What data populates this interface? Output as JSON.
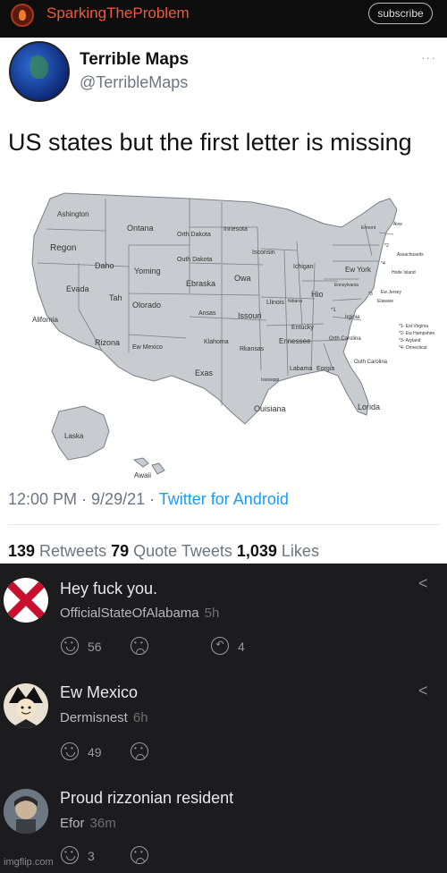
{
  "channel": {
    "name": "SparkingTheProblem",
    "subscribe_label": "subscribe"
  },
  "tweet": {
    "display_name": "Terrible Maps",
    "handle": "@TerribleMaps",
    "more": "···",
    "text": "US states but the first letter is missing",
    "time": "12:00 PM · 9/29/21 · ",
    "source": "Twitter for Android",
    "stats": {
      "retweets_count": "139",
      "retweets_label": " Retweets  ",
      "quotes_count": "79",
      "quotes_label": " Quote Tweets  ",
      "likes_count": "1,039",
      "likes_label": " Likes"
    }
  },
  "map": {
    "states": {
      "wa": "Ashington",
      "or": "Regon",
      "ca": "Alifornia",
      "nv": "Evada",
      "id": "Daho",
      "mt": "Ontana",
      "wy": "Yoming",
      "ut": "Tah",
      "az": "Rizona",
      "co": "Olorado",
      "nm": "Ew Mexico",
      "nd": "Orth Dakota",
      "sd": "Outh Dakota",
      "ne": "Ebraska",
      "ks": "Ansas",
      "ok": "Klahoma",
      "tx": "Exas",
      "mn": "Innesota",
      "ia": "Owa",
      "mo": "Issouri",
      "ar": "Rkansas",
      "la": "Ouisiana",
      "wi": "Isconsin",
      "il": "Llinois",
      "ms": "Ississippi",
      "mi": "Ichigan",
      "in": "Ndiana",
      "oh": "Hio",
      "ky": "Entucky",
      "tn": "Ennessee",
      "al": "Labama",
      "ga": "Eorgia",
      "fl": "Lorida",
      "sc": "Outh Carolina",
      "nc": "Orth Carolina",
      "va": "Irginia",
      "wv": "*1",
      "pa": "Ennsylvania",
      "ny": "Ew York",
      "nj": "Ew Jersey",
      "de": "Elaware",
      "md": "*3",
      "ct": "*4",
      "ri": "Hode Island",
      "ma": "Assachusetts",
      "vt": "Ermont",
      "nh": "*2",
      "me": "Aine",
      "ak": "Laska",
      "hi": "Awaii"
    },
    "legend": [
      "*1- Est Virginia",
      "*2- Ew Hampshire",
      "*3- Aryland",
      "*4- Onnecticut"
    ],
    "fill": "#c8ccd0",
    "stroke": "#7a7f85"
  },
  "comments": [
    {
      "text": "Hey fuck you.",
      "user": "OfficialStateOfAlabama",
      "time": "5h",
      "likes": "56",
      "replies": "4"
    },
    {
      "text": "Ew Mexico",
      "user": "Dermisnest",
      "time": "6h",
      "likes": "49"
    },
    {
      "text": "Proud rizzonian resident",
      "user": "Efor",
      "time": "36m",
      "likes": "3"
    }
  ],
  "watermark": "imgflip.com",
  "colors": {
    "accent": "#1d9bf0",
    "channel": "#f05a3a",
    "dark_bg": "#1c1c1e"
  }
}
